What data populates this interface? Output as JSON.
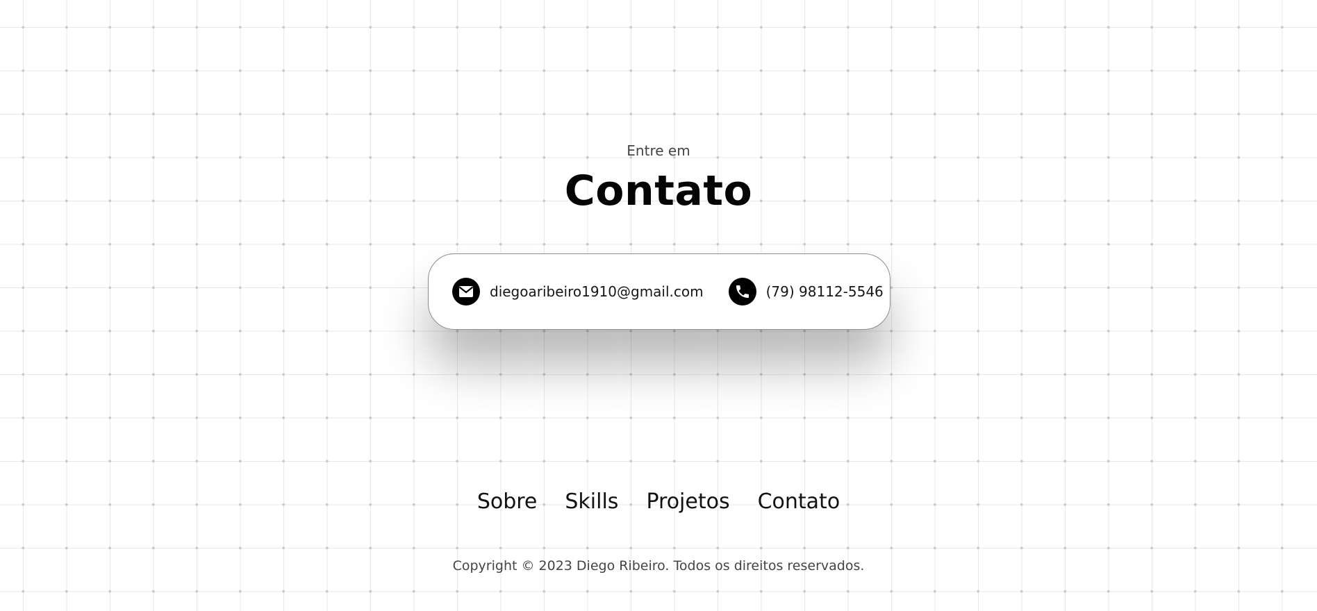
{
  "contact_section": {
    "subtitle": "Entre em",
    "title": "Contato",
    "email": {
      "icon": "mail-icon",
      "text": "diegoaribeiro1910@gmail.com"
    },
    "phone": {
      "icon": "phone-icon",
      "text": "(79) 98112-5546"
    }
  },
  "footer": {
    "nav": [
      {
        "label": "Sobre"
      },
      {
        "label": "Skills"
      },
      {
        "label": "Projetos"
      },
      {
        "label": "Contato"
      }
    ],
    "copyright": "Copyright © 2023 Diego Ribeiro. Todos os direitos reservados."
  },
  "colors": {
    "background": "#ffffff",
    "grid_line": "#e9e9e9",
    "grid_dot": "#c9c9c9",
    "text_primary": "#050505",
    "text_secondary": "#444444",
    "icon_background": "#000000"
  }
}
